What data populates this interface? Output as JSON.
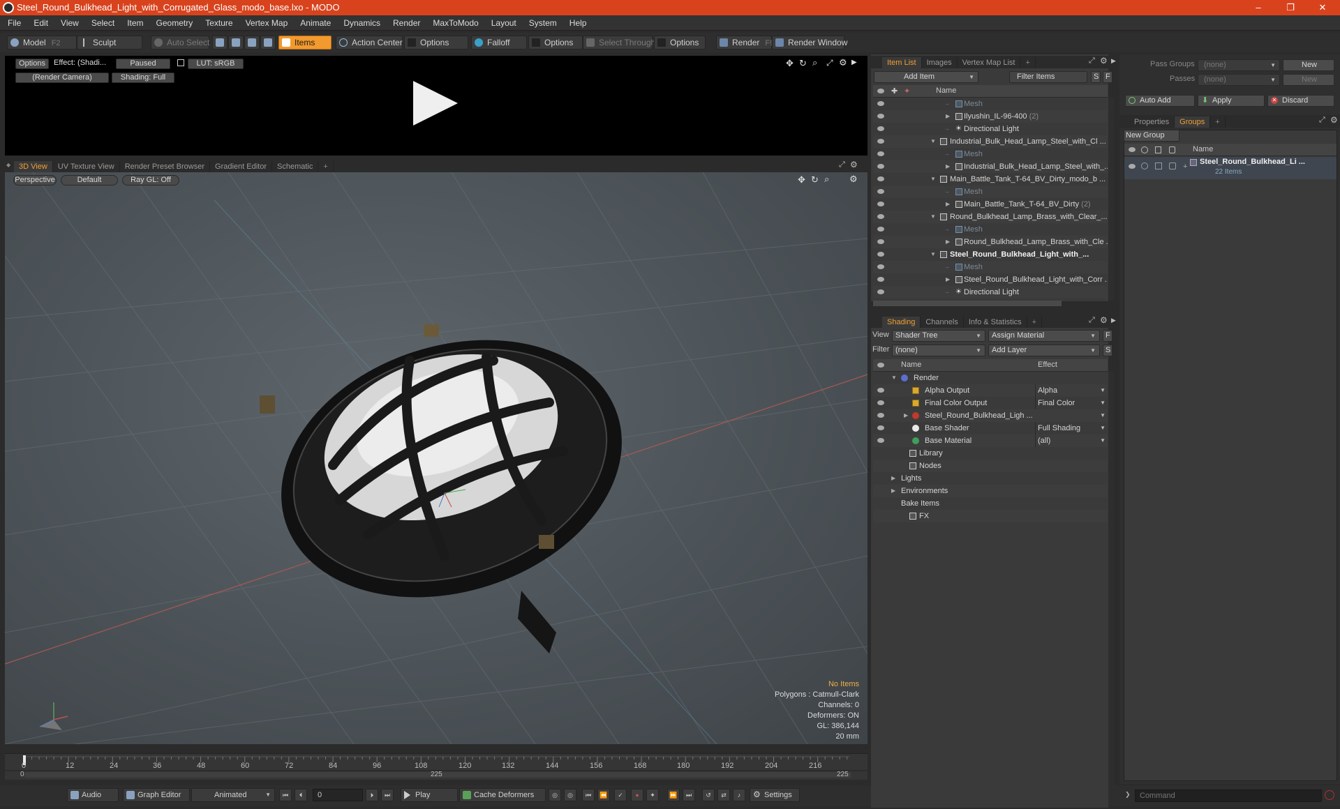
{
  "window": {
    "title": "Steel_Round_Bulkhead_Light_with_Corrugated_Glass_modo_base.lxo - MODO"
  },
  "menu": [
    "File",
    "Edit",
    "View",
    "Select",
    "Item",
    "Geometry",
    "Texture",
    "Vertex Map",
    "Animate",
    "Dynamics",
    "Render",
    "MaxToModo",
    "Layout",
    "System",
    "Help"
  ],
  "toolbar": {
    "model": "Model",
    "model_key": "F2",
    "sculpt": "Sculpt",
    "auto_select": "Auto Select",
    "items": "Items",
    "action_center": "Action Center",
    "options1": "Options",
    "falloff": "Falloff",
    "options2": "Options",
    "select_through": "Select Through",
    "options3": "Options",
    "render": "Render",
    "render_key": "F9",
    "render_window": "Render Window"
  },
  "render_preview": {
    "options": "Options",
    "effect": "Effect: (Shadi...",
    "paused": "Paused",
    "lut": "LUT: sRGB",
    "camera": "(Render Camera)",
    "shading": "Shading: Full"
  },
  "viewport_tabs": [
    "3D View",
    "UV Texture View",
    "Render Preset Browser",
    "Gradient Editor",
    "Schematic",
    "+"
  ],
  "viewport": {
    "perspective": "Perspective",
    "default": "Default",
    "raygl": "Ray GL: Off",
    "info": {
      "no_items": "No Items",
      "polygons": "Polygons : Catmull-Clark",
      "channels": "Channels: 0",
      "deformers": "Deformers: ON",
      "gl": "GL: 386,144",
      "scale": "20 mm"
    }
  },
  "item_list": {
    "tabs": [
      "Item List",
      "Images",
      "Vertex Map List",
      "+"
    ],
    "add_item": "Add Item",
    "filter": "Filter Items",
    "s_btn": "S",
    "f_btn": "F",
    "col_name": "Name",
    "rows": [
      {
        "text": "Mesh",
        "type": "mesh",
        "indent": 2
      },
      {
        "text": "Ilyushin_IL-96-400",
        "count": "(2)",
        "type": "group",
        "indent": 2
      },
      {
        "text": "Directional Light",
        "type": "light",
        "indent": 2
      },
      {
        "text": "Industrial_Bulk_Head_Lamp_Steel_with_Cl ...",
        "type": "scene",
        "indent": 1
      },
      {
        "text": "Mesh",
        "type": "mesh",
        "indent": 2
      },
      {
        "text": "Industrial_Bulk_Head_Lamp_Steel_with_...",
        "type": "group",
        "indent": 2
      },
      {
        "text": "Main_Battle_Tank_T-64_BV_Dirty_modo_b ...",
        "type": "scene",
        "indent": 1
      },
      {
        "text": "Mesh",
        "type": "mesh",
        "indent": 2
      },
      {
        "text": "Main_Battle_Tank_T-64_BV_Dirty",
        "count": "(2)",
        "type": "group",
        "indent": 2
      },
      {
        "text": "Round_Bulkhead_Lamp_Brass_with_Clear_...",
        "type": "scene",
        "indent": 1
      },
      {
        "text": "Mesh",
        "type": "mesh",
        "indent": 2
      },
      {
        "text": "Round_Bulkhead_Lamp_Brass_with_Cle ...",
        "type": "group",
        "indent": 2
      },
      {
        "text": "Steel_Round_Bulkhead_Light_with_...",
        "type": "scene",
        "indent": 1,
        "bold": true
      },
      {
        "text": "Mesh",
        "type": "mesh",
        "indent": 2
      },
      {
        "text": "Steel_Round_Bulkhead_Light_with_Corr ...",
        "type": "group",
        "indent": 2
      },
      {
        "text": "Directional Light",
        "type": "light",
        "indent": 2
      }
    ]
  },
  "shading": {
    "tabs": [
      "Shading",
      "Channels",
      "Info & Statistics",
      "+"
    ],
    "view_label": "View",
    "view_value": "Shader Tree",
    "assign": "Assign Material",
    "f_btn": "F",
    "filter_label": "Filter",
    "filter_value": "(none)",
    "add_layer": "Add Layer",
    "s_btn": "S",
    "col_name": "Name",
    "col_effect": "Effect",
    "rows": [
      {
        "text": "Render",
        "effect": "",
        "icon": "render",
        "indent": 0
      },
      {
        "text": "Alpha Output",
        "effect": "Alpha",
        "icon": "output",
        "indent": 1
      },
      {
        "text": "Final Color Output",
        "effect": "Final Color",
        "icon": "output",
        "indent": 1
      },
      {
        "text": "Steel_Round_Bulkhead_Ligh ...",
        "effect": "",
        "icon": "material-group",
        "indent": 1
      },
      {
        "text": "Base Shader",
        "effect": "Full Shading",
        "icon": "shader",
        "indent": 1
      },
      {
        "text": "Base Material",
        "effect": "(all)",
        "icon": "material",
        "indent": 1
      },
      {
        "text": "Library",
        "effect": "",
        "icon": "folder",
        "indent": 1
      },
      {
        "text": "Nodes",
        "effect": "",
        "icon": "folder",
        "indent": 1
      },
      {
        "text": "Lights",
        "effect": "",
        "icon": "none",
        "indent": 0
      },
      {
        "text": "Environments",
        "effect": "",
        "icon": "none",
        "indent": 0
      },
      {
        "text": "Bake Items",
        "effect": "",
        "icon": "none",
        "indent": 0
      },
      {
        "text": "FX",
        "effect": "",
        "icon": "fx",
        "indent": 1
      }
    ]
  },
  "groups_panel": {
    "pass_groups_label": "Pass Groups",
    "pass_groups_value": "(none)",
    "new": "New",
    "passes_label": "Passes",
    "passes_value": "(none)",
    "new2": "New",
    "auto_add": "Auto Add",
    "apply": "Apply",
    "discard": "Discard",
    "tabs": [
      "Properties",
      "Groups",
      "+"
    ],
    "new_group": "New Group",
    "col_name": "Name",
    "group_name": "Steel_Round_Bulkhead_Li ...",
    "group_count": "22 Items"
  },
  "timeline": {
    "ticks": [
      "0",
      "12",
      "24",
      "36",
      "48",
      "60",
      "72",
      "84",
      "96",
      "108",
      "120",
      "132",
      "144",
      "156",
      "168",
      "180",
      "192",
      "204",
      "216"
    ],
    "range_start": "0",
    "range_mid": "225",
    "range_end": "225"
  },
  "bottombar": {
    "audio": "Audio",
    "graph_editor": "Graph Editor",
    "animated": "Animated",
    "frame": "0",
    "play": "Play",
    "cache_deformers": "Cache Deformers",
    "settings": "Settings",
    "command_placeholder": "Command"
  }
}
